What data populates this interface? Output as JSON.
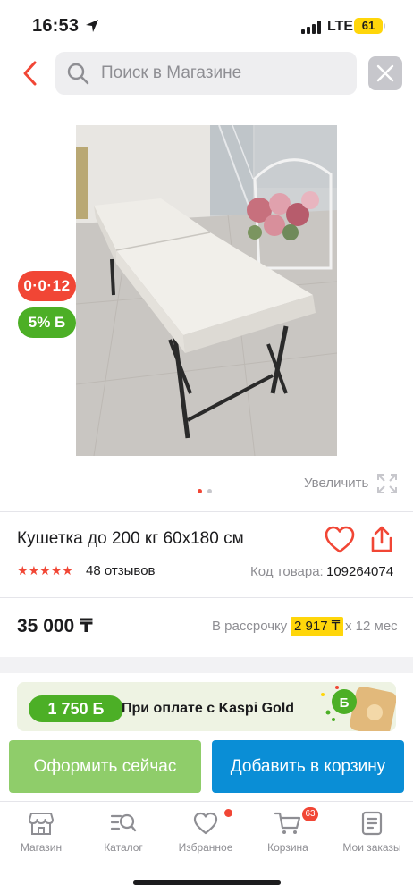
{
  "status_bar": {
    "time": "16:53",
    "network": "LTE",
    "battery": "61"
  },
  "header": {
    "search_placeholder": "Поиск в Магазине"
  },
  "badges": {
    "installment": "0·0·12",
    "bonus": "5% Б"
  },
  "gallery": {
    "zoom_label": "Увеличить",
    "pages": 2,
    "active_page": 1
  },
  "product": {
    "title": "Кушетка до 200 кг 60x180 см",
    "rating_stars": 5,
    "reviews": "48 отзывов",
    "code_label": "Код товара:",
    "code_value": "109264074",
    "price": "35 000 ₸",
    "installment_label": "В рассрочку",
    "installment_amount": "2 917 ₸",
    "installment_term": "х 12 мес"
  },
  "promo": {
    "bonus_amount": "1 750 Б",
    "text": "При оплате с Kaspi Gold"
  },
  "actions": {
    "buy_now": "Оформить сейчас",
    "add_to_cart": "Добавить в корзину"
  },
  "tabbar": {
    "items": [
      {
        "label": "Магазин",
        "icon": "shop-icon"
      },
      {
        "label": "Каталог",
        "icon": "catalog-search-icon"
      },
      {
        "label": "Избранное",
        "icon": "heart-icon"
      },
      {
        "label": "Корзина",
        "icon": "cart-icon",
        "count": "63"
      },
      {
        "label": "Мои заказы",
        "icon": "orders-icon"
      }
    ]
  },
  "colors": {
    "accent_red": "#f14635",
    "bonus_green": "#4caf26",
    "buy_green": "#8fcd6a",
    "cart_blue": "#0a8ed6",
    "installment_yellow": "#ffd60a"
  }
}
